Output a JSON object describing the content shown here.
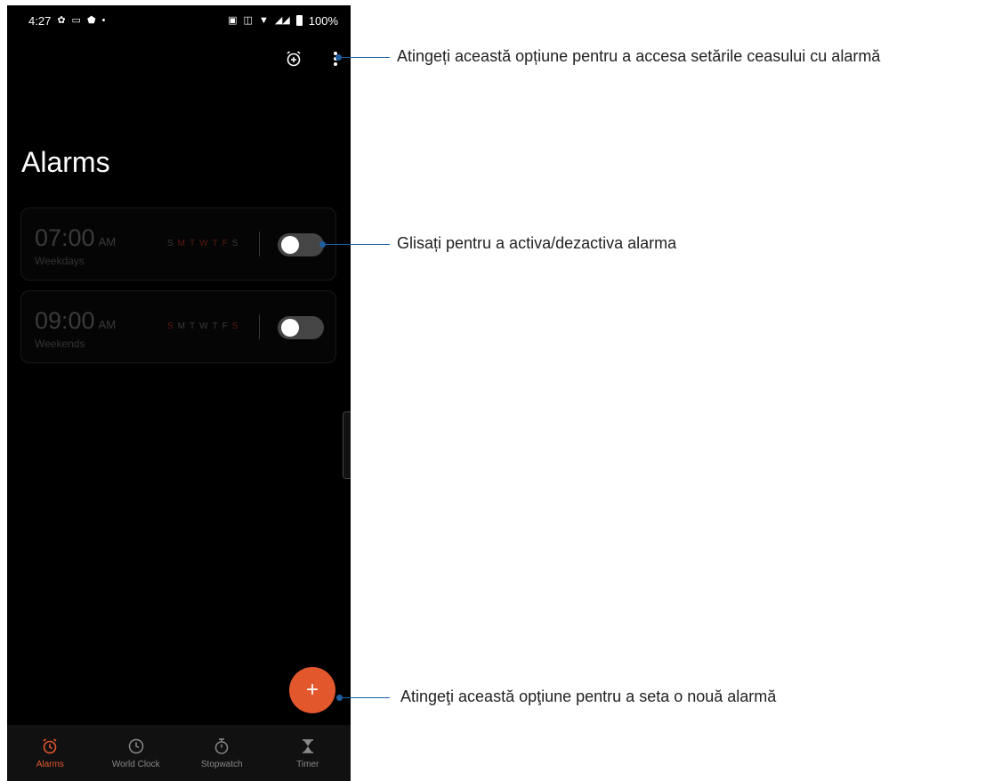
{
  "status_bar": {
    "time": "4:27",
    "battery": "100%"
  },
  "screen": {
    "title": "Alarms",
    "alarms": [
      {
        "time": "07:00",
        "ampm": "AM",
        "label": "Weekdays",
        "days": [
          "S",
          "M",
          "T",
          "W",
          "T",
          "F",
          "S"
        ],
        "active_days": [
          false,
          true,
          true,
          true,
          true,
          true,
          false
        ],
        "enabled": false
      },
      {
        "time": "09:00",
        "ampm": "AM",
        "label": "Weekends",
        "days": [
          "S",
          "M",
          "T",
          "W",
          "T",
          "F",
          "S"
        ],
        "active_days": [
          true,
          false,
          false,
          false,
          false,
          false,
          true
        ],
        "enabled": false
      }
    ],
    "fab_label": "+"
  },
  "bottom_nav": {
    "items": [
      {
        "label": "Alarms",
        "icon": "alarm-clock-icon",
        "active": true
      },
      {
        "label": "World Clock",
        "icon": "clock-icon",
        "active": false
      },
      {
        "label": "Stopwatch",
        "icon": "stopwatch-icon",
        "active": false
      },
      {
        "label": "Timer",
        "icon": "hourglass-icon",
        "active": false
      }
    ]
  },
  "callouts": {
    "settings": "Atingeți această opțiune pentru a accesa setările ceasului cu alarmă",
    "toggle": "Glisați pentru a activa/dezactiva alarma",
    "add": "Atingeţi această opţiune pentru a seta o nouă alarmă"
  },
  "colors": {
    "accent": "#e2572c",
    "callout_line": "#1f5fa0",
    "background": "#000000"
  }
}
